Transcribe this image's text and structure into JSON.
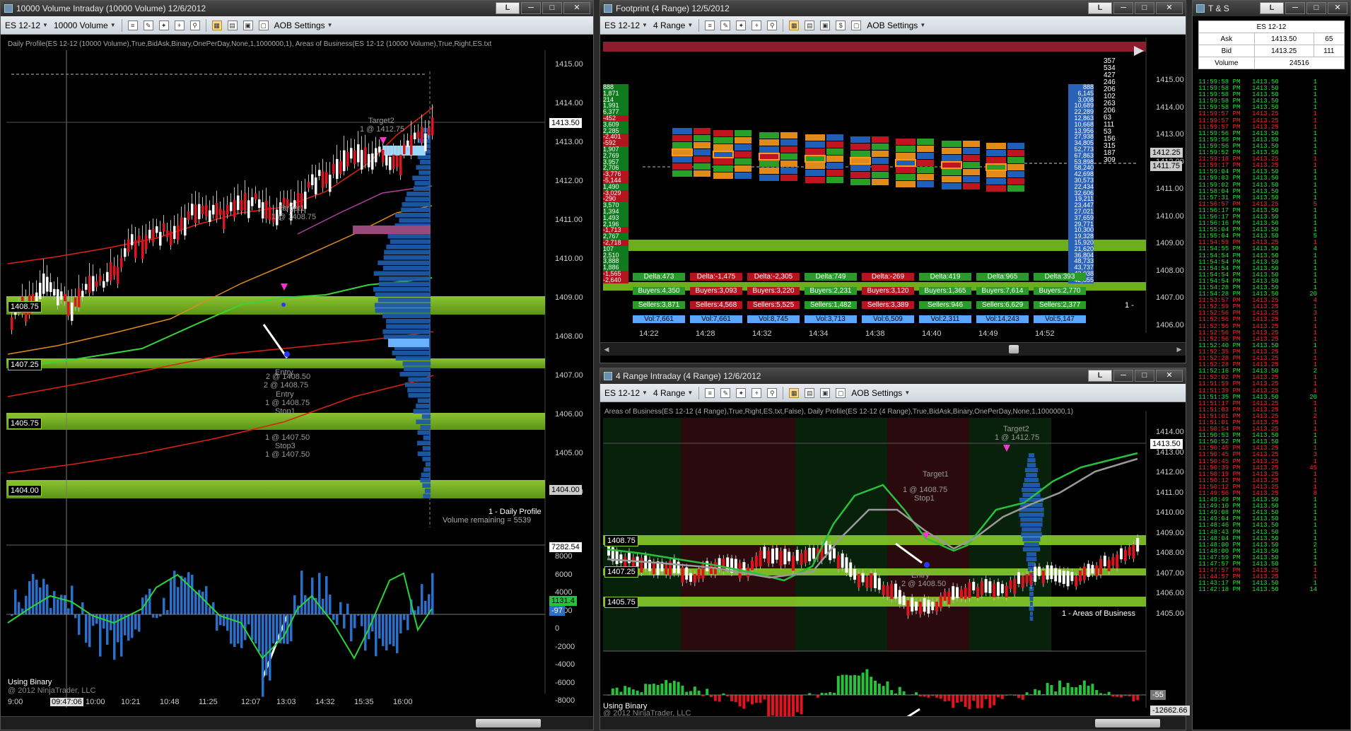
{
  "colors": {
    "up": "#00d000",
    "down": "#e00000",
    "accent_green": "#8dd62b",
    "blue_bar": "#2a6fc9",
    "profile_blue": "#1e5aa8",
    "current_price": "#ffffff"
  },
  "left_window": {
    "title": "10000 Volume Intraday (10000 Volume)  12/6/2012",
    "toolbar": {
      "instrument": "ES 12-12",
      "period": "10000 Volume",
      "aob": "AOB Settings"
    },
    "indicator_header": "Daily Profile(ES 12-12 (10000 Volume),True,BidAsk,Binary,OnePerDay,None,1,1000000,1), Areas of Business(ES 12-12 (10000 Volume),True,Right,ES.txt",
    "price_axis": [
      "1415.00",
      "1414.00",
      "1413.00",
      "1412.00",
      "1411.00",
      "1410.00",
      "1409.00",
      "1408.00",
      "1407.00",
      "1406.00",
      "1405.00",
      "1404.00"
    ],
    "current_price": "1413.50",
    "aob_levels": [
      "1408.75",
      "1407.25",
      "1405.75",
      "1404.00"
    ],
    "aob_right_label": "1404.00",
    "annotations": {
      "target2": "Target2",
      "target2_qty": "1 @ 1412.75",
      "target1": "Target1",
      "target1_qty": "1 @ 1408.75",
      "entry1": "2 @ 1408.50",
      "entry_label": "Entry",
      "entry2": "2 @ 1408.75",
      "entry3": "Entry",
      "entry3_qty": "1 @ 1408.75",
      "stop1": "Stop1",
      "stop1_qty": "1 @ 1407.50",
      "stop3": "Stop3",
      "stop3_qty": "1 @ 1407.50"
    },
    "profile_label": "1 - Daily Profile",
    "volume_remaining": "Volume remaining = 5539",
    "osc_axis": [
      "8000",
      "6000",
      "4000",
      "2000",
      "0",
      "-2000",
      "-4000",
      "-6000",
      "-8000"
    ],
    "osc_tags": {
      "top": "7282.54",
      "mid": "1131.4",
      "low": "-97"
    },
    "using": "Using Binary",
    "copyright": "@ 2012 NinjaTrader, LLC",
    "time_axis": [
      "9:00",
      "09:47:06",
      "10:00",
      "10:21",
      "10:48",
      "11:25",
      "12:07",
      "13:03",
      "14:32",
      "15:35",
      "16:00"
    ]
  },
  "footprint_window": {
    "title": "Footprint (4 Range)  12/5/2012",
    "toolbar": {
      "instrument": "ES 12-12",
      "period": "4 Range",
      "aob": "AOB Settings"
    },
    "price_axis": [
      "1415.00",
      "1414.00",
      "1413.00",
      "1412.00",
      "1411.00",
      "1410.00",
      "1409.00",
      "1408.00",
      "1407.00",
      "1406.00"
    ],
    "price_tags": [
      "1412.25",
      "1411.75"
    ],
    "left_ladder": [
      "888",
      "1,871",
      "214",
      "1,991",
      "6,377",
      "-452",
      "3,609",
      "2,285",
      "-2,401",
      "-592",
      "1,907",
      "2,769",
      "3,957",
      "2,706",
      "-3,776",
      "-5,144",
      "1,490",
      "-3,029",
      "-290",
      "3,570",
      "1,394",
      "1,493",
      "2,196",
      "-1,713",
      "2,767",
      "-2,718",
      "107",
      "2,510",
      "3,888",
      "1,886",
      "-1,565",
      "-2,640"
    ],
    "right_ladder": [
      "888",
      "6,145",
      "3,008",
      "10,689",
      "22,289",
      "12,863",
      "10,668",
      "13,956",
      "27,938",
      "34,805",
      "52,773",
      "67,863",
      "53,898",
      "58,240",
      "42,698",
      "30,573",
      "22,434",
      "32,606",
      "19,211",
      "23,447",
      "27,021",
      "37,659",
      "29,771",
      "10,300",
      "19,328",
      "15,920",
      "21,620",
      "36,804",
      "48,733",
      "43,737",
      "43,038",
      "42,855"
    ],
    "right_col2": [
      "357",
      "534",
      "427",
      "246",
      "206",
      "102",
      "263",
      "206",
      "63",
      "111",
      "53",
      "156",
      "315",
      "187",
      "309"
    ],
    "stats": [
      {
        "delta": "Delta:473",
        "buyers": "Buyers:4,350",
        "sellers": "Sellers:3,871",
        "vol": "Vol:7,661",
        "color": "green"
      },
      {
        "delta": "Delta:-1,475",
        "buyers": "Buyers:3,093",
        "sellers": "Sellers:4,568",
        "vol": "Vol:7,661",
        "color": "red"
      },
      {
        "delta": "Delta:-2,305",
        "buyers": "Buyers:3,220",
        "sellers": "Sellers:5,525",
        "vol": "Vol:8,745",
        "color": "red"
      },
      {
        "delta": "Delta:749",
        "buyers": "Buyers:2,231",
        "sellers": "Sellers:1,482",
        "vol": "Vol:3,713",
        "color": "green"
      },
      {
        "delta": "Delta:-269",
        "buyers": "Buyers:3,120",
        "sellers": "Sellers:3,389",
        "vol": "Vol:6,509",
        "color": "red"
      },
      {
        "delta": "Delta:419",
        "buyers": "Buyers:1,365",
        "sellers": "Sellers:946",
        "vol": "Vol:2,311",
        "color": "green"
      },
      {
        "delta": "Delta:965",
        "buyers": "Buyers:7,614",
        "sellers": "Sellers:6,629",
        "vol": "Vol:14,243",
        "color": "green"
      },
      {
        "delta": "Delta:393",
        "buyers": "Buyers:2,770",
        "sellers": "Sellers:2,377",
        "vol": "Vol:5,147",
        "color": "green"
      }
    ],
    "time_axis": [
      "14:22",
      "14:28",
      "14:32",
      "14:34",
      "14:38",
      "14:40",
      "14:49",
      "14:52"
    ],
    "corner_label": "1 -"
  },
  "range_window": {
    "title": "4 Range Intraday (4 Range)  12/6/2012",
    "toolbar": {
      "instrument": "ES 12-12",
      "period": "4 Range",
      "aob": "AOB Settings"
    },
    "indicator_header": "Areas of Business(ES 12-12 (4 Range),True,Right,ES.txt,False), Daily Profile(ES 12-12 (4 Range),True,BidAsk,Binary,OnePerDay,None,1,1000000,1)",
    "price_axis": [
      "1414.00",
      "1413.00",
      "1412.00",
      "1411.00",
      "1410.00",
      "1409.00",
      "1408.00",
      "1407.00",
      "1406.00",
      "1405.00"
    ],
    "current_price": "1413.50",
    "aob_levels": [
      "1408.75",
      "1407.25",
      "1405.75"
    ],
    "annotations": {
      "target2": "Target2",
      "target2_qty": "1 @ 1412.75",
      "target1": "Target1",
      "target1_qty": "1 @ 1408.75",
      "stop1": "Stop1",
      "entry": "Entry",
      "entry_qty": "2 @ 1408.50"
    },
    "aob_label": "1 - Areas of Business",
    "osc_tags": {
      "mid": "-55",
      "low": "-12662.66"
    },
    "using": "Using Binary",
    "copyright": "@ 2012 NinjaTrader, LLC",
    "time_axis": [
      "09:45:03",
      "09:51",
      "10:00",
      "10:10",
      "10:21",
      "10:37",
      "11:04",
      "12:07",
      "12:59",
      "14:15",
      "15:32",
      "18:09"
    ]
  },
  "ts_window": {
    "title": "T & S",
    "header": {
      "instrument": "ES 12-12",
      "ask_label": "Ask",
      "ask_price": "1413.50",
      "ask_size": "65",
      "bid_label": "Bid",
      "bid_price": "1413.25",
      "bid_size": "111",
      "vol_label": "Volume",
      "vol_value": "24516"
    },
    "rows": [
      [
        "11:59:58 PM",
        "1413.50",
        "1",
        "g"
      ],
      [
        "11:59:58 PM",
        "1413.50",
        "1",
        "g"
      ],
      [
        "11:59:58 PM",
        "1413.50",
        "1",
        "g"
      ],
      [
        "11:59:58 PM",
        "1413.50",
        "1",
        "g"
      ],
      [
        "11:59:58 PM",
        "1413.50",
        "1",
        "g"
      ],
      [
        "11:59:57 PM",
        "1413.25",
        "1",
        "r"
      ],
      [
        "11:59:57 PM",
        "1413.25",
        "1",
        "r"
      ],
      [
        "11:59:57 PM",
        "1413.25",
        "1",
        "r"
      ],
      [
        "11:59:56 PM",
        "1413.50",
        "1",
        "g"
      ],
      [
        "11:59:56 PM",
        "1413.50",
        "1",
        "g"
      ],
      [
        "11:59:56 PM",
        "1413.50",
        "1",
        "g"
      ],
      [
        "11:59:52 PM",
        "1413.50",
        "1",
        "g"
      ],
      [
        "11:59:18 PM",
        "1413.25",
        "1",
        "r"
      ],
      [
        "11:59:17 PM",
        "1413.25",
        "1",
        "r"
      ],
      [
        "11:59:04 PM",
        "1413.50",
        "1",
        "g"
      ],
      [
        "11:59:03 PM",
        "1413.50",
        "1",
        "g"
      ],
      [
        "11:59:02 PM",
        "1413.50",
        "1",
        "g"
      ],
      [
        "11:58:04 PM",
        "1413.50",
        "1",
        "g"
      ],
      [
        "11:57:31 PM",
        "1413.50",
        "1",
        "g"
      ],
      [
        "11:56:57 PM",
        "1413.25",
        "5",
        "r"
      ],
      [
        "11:56:17 PM",
        "1413.50",
        "1",
        "g"
      ],
      [
        "11:56:17 PM",
        "1413.50",
        "1",
        "g"
      ],
      [
        "11:56:16 PM",
        "1413.50",
        "1",
        "g"
      ],
      [
        "11:55:04 PM",
        "1413.50",
        "1",
        "g"
      ],
      [
        "11:55:04 PM",
        "1413.50",
        "5",
        "g"
      ],
      [
        "11:54:59 PM",
        "1413.25",
        "1",
        "r"
      ],
      [
        "11:54:55 PM",
        "1413.50",
        "4",
        "g"
      ],
      [
        "11:54:54 PM",
        "1413.50",
        "1",
        "g"
      ],
      [
        "11:54:54 PM",
        "1413.50",
        "1",
        "g"
      ],
      [
        "11:54:54 PM",
        "1413.50",
        "1",
        "g"
      ],
      [
        "11:54:54 PM",
        "1413.50",
        "1",
        "g"
      ],
      [
        "11:54:54 PM",
        "1413.50",
        "1",
        "g"
      ],
      [
        "11:54:28 PM",
        "1413.50",
        "1",
        "g"
      ],
      [
        "11:54:28 PM",
        "1413.50",
        "20",
        "g"
      ],
      [
        "11:53:57 PM",
        "1413.25",
        "4",
        "r"
      ],
      [
        "11:52:59 PM",
        "1413.25",
        "1",
        "r"
      ],
      [
        "11:52:56 PM",
        "1413.25",
        "3",
        "r"
      ],
      [
        "11:52:56 PM",
        "1413.25",
        "1",
        "r"
      ],
      [
        "11:52:56 PM",
        "1413.25",
        "1",
        "r"
      ],
      [
        "11:52:56 PM",
        "1413.25",
        "1",
        "r"
      ],
      [
        "11:52:56 PM",
        "1413.25",
        "1",
        "r"
      ],
      [
        "11:52:40 PM",
        "1413.50",
        "1",
        "g"
      ],
      [
        "11:52:35 PM",
        "1413.25",
        "1",
        "r"
      ],
      [
        "11:52:28 PM",
        "1413.25",
        "1",
        "r"
      ],
      [
        "11:52:28 PM",
        "1413.25",
        "1",
        "r"
      ],
      [
        "11:52:16 PM",
        "1413.50",
        "2",
        "g"
      ],
      [
        "11:52:02 PM",
        "1413.25",
        "1",
        "r"
      ],
      [
        "11:51:59 PM",
        "1413.25",
        "1",
        "r"
      ],
      [
        "11:51:39 PM",
        "1413.25",
        "1",
        "r"
      ],
      [
        "11:51:35 PM",
        "1413.50",
        "20",
        "g"
      ],
      [
        "11:51:17 PM",
        "1413.25",
        "1",
        "r"
      ],
      [
        "11:51:03 PM",
        "1413.25",
        "1",
        "r"
      ],
      [
        "11:51:01 PM",
        "1413.25",
        "2",
        "r"
      ],
      [
        "11:51:01 PM",
        "1413.25",
        "1",
        "r"
      ],
      [
        "11:50:54 PM",
        "1413.25",
        "1",
        "r"
      ],
      [
        "11:50:53 PM",
        "1413.50",
        "1",
        "g"
      ],
      [
        "11:50:52 PM",
        "1413.50",
        "1",
        "g"
      ],
      [
        "11:50:45 PM",
        "1413.25",
        "1",
        "r"
      ],
      [
        "11:50:45 PM",
        "1413.25",
        "3",
        "r"
      ],
      [
        "11:50:45 PM",
        "1413.25",
        "1",
        "r"
      ],
      [
        "11:50:39 PM",
        "1413.25",
        "45",
        "r"
      ],
      [
        "11:50:19 PM",
        "1413.25",
        "1",
        "r"
      ],
      [
        "11:50:12 PM",
        "1413.25",
        "1",
        "r"
      ],
      [
        "11:50:12 PM",
        "1413.25",
        "1",
        "r"
      ],
      [
        "11:49:56 PM",
        "1413.25",
        "8",
        "r"
      ],
      [
        "11:49:49 PM",
        "1413.50",
        "1",
        "g"
      ],
      [
        "11:49:10 PM",
        "1413.50",
        "1",
        "g"
      ],
      [
        "11:49:08 PM",
        "1413.50",
        "1",
        "g"
      ],
      [
        "11:49:04 PM",
        "1413.50",
        "1",
        "g"
      ],
      [
        "11:48:46 PM",
        "1413.50",
        "1",
        "g"
      ],
      [
        "11:48:43 PM",
        "1413.50",
        "1",
        "g"
      ],
      [
        "11:48:04 PM",
        "1413.50",
        "1",
        "g"
      ],
      [
        "11:48:00 PM",
        "1413.50",
        "2",
        "g"
      ],
      [
        "11:48:00 PM",
        "1413.50",
        "1",
        "g"
      ],
      [
        "11:47:59 PM",
        "1413.50",
        "1",
        "g"
      ],
      [
        "11:47:57 PM",
        "1413.50",
        "1",
        "g"
      ],
      [
        "11:47:57 PM",
        "1413.25",
        "1",
        "r"
      ],
      [
        "11:44:57 PM",
        "1413.25",
        "1",
        "r"
      ],
      [
        "11:43:17 PM",
        "1413.50",
        "1",
        "g"
      ],
      [
        "11:42:18 PM",
        "1413.50",
        "14",
        "g"
      ]
    ]
  }
}
